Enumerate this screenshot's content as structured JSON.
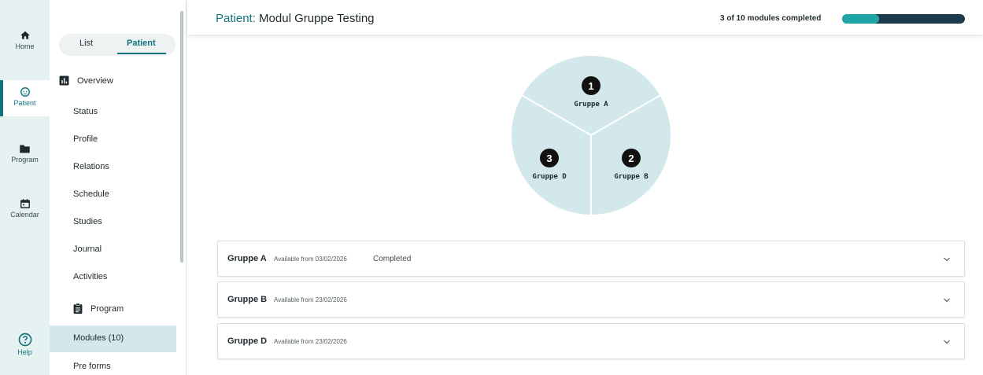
{
  "rail": {
    "items": [
      {
        "label": "Home",
        "icon": "home-icon"
      },
      {
        "label": "Patient",
        "icon": "patient-face-icon"
      },
      {
        "label": "Program",
        "icon": "folder-icon"
      },
      {
        "label": "Calendar",
        "icon": "calendar-icon"
      },
      {
        "label": "Help",
        "icon": "help-icon"
      }
    ],
    "active": "Patient"
  },
  "subnav": {
    "toggle": {
      "list": "List",
      "patient": "Patient"
    },
    "overview": "Overview",
    "patient_links": [
      "Status",
      "Profile",
      "Relations",
      "Schedule",
      "Studies",
      "Journal",
      "Activities"
    ],
    "program": "Program",
    "program_links": [
      "Modules (10)",
      "Pre forms"
    ]
  },
  "header": {
    "title_prefix": "Patient:",
    "title_name": "Modul Gruppe Testing",
    "progress_text": "3 of 10 modules completed",
    "progress_fraction": 0.3
  },
  "pie": {
    "segments": [
      {
        "number": "1",
        "label": "Gruppe A"
      },
      {
        "number": "2",
        "label": "Gruppe B"
      },
      {
        "number": "3",
        "label": "Gruppe D"
      }
    ]
  },
  "modules": [
    {
      "name": "Gruppe A",
      "available": "Available from 03/02/2026",
      "status": "Completed"
    },
    {
      "name": "Gruppe B",
      "available": "Available from 23/02/2026",
      "status": ""
    },
    {
      "name": "Gruppe D",
      "available": "Available from 23/02/2026",
      "status": ""
    }
  ],
  "colors": {
    "accent": "#11747d",
    "pie_fill": "#d3e8ea",
    "progress_track": "#1b3a4b",
    "progress_fill": "#1fa5a8"
  }
}
